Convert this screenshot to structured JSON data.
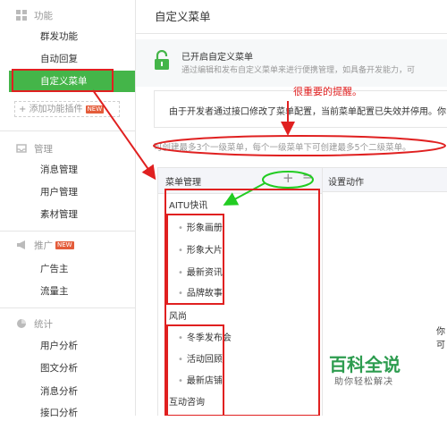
{
  "sidebar": {
    "sections": [
      {
        "label": "功能",
        "icon": "grid-icon",
        "items": [
          {
            "label": "群发功能"
          },
          {
            "label": "自动回复"
          },
          {
            "label": "自定义菜单",
            "active": true
          }
        ],
        "add_plugin": {
          "label": "+ 添加功能插件",
          "badge": "NEW"
        }
      },
      {
        "label": "管理",
        "icon": "inbox-icon",
        "items": [
          {
            "label": "消息管理"
          },
          {
            "label": "用户管理"
          },
          {
            "label": "素材管理"
          }
        ]
      },
      {
        "label": "推广",
        "icon": "megaphone-icon",
        "badge": "NEW",
        "items": [
          {
            "label": "广告主"
          },
          {
            "label": "流量主"
          }
        ]
      },
      {
        "label": "统计",
        "icon": "chart-icon",
        "items": [
          {
            "label": "用户分析"
          },
          {
            "label": "图文分析"
          },
          {
            "label": "消息分析"
          },
          {
            "label": "接口分析"
          }
        ]
      }
    ]
  },
  "main": {
    "title": "自定义菜单",
    "notice": {
      "title": "已开启自定义菜单",
      "desc": "通过编辑和发布自定义菜单来进行便携管理，如具备开发能力，可"
    },
    "warning": "由于开发者通过接口修改了菜单配置，当前菜单配置已失效并停用。你",
    "limits": "可创建最多3个一级菜单，每个一级菜单下可创建最多5个二级菜单。",
    "annotation": "很重要的提醒。",
    "menu_panel": {
      "header": "菜单管理",
      "add_symbol": "+",
      "sort_symbol": "=",
      "menus": [
        {
          "label": "AITU快讯",
          "subs": [
            "形象画册",
            "形象大片",
            "最新资讯",
            "品牌故事"
          ]
        },
        {
          "label": "风尚",
          "subs": [
            "冬季发布会",
            "活动回顾",
            "最新店铺"
          ]
        },
        {
          "label": "互动咨询",
          "subs": []
        }
      ]
    },
    "action_panel": {
      "header": "设置动作",
      "peek_text": "你可"
    }
  },
  "watermark": {
    "title": "百科全说",
    "subtitle": "助你轻松解决"
  },
  "colors": {
    "accent_green": "#44b549",
    "highlight_red": "#e02020",
    "highlight_green": "#22cc22"
  }
}
